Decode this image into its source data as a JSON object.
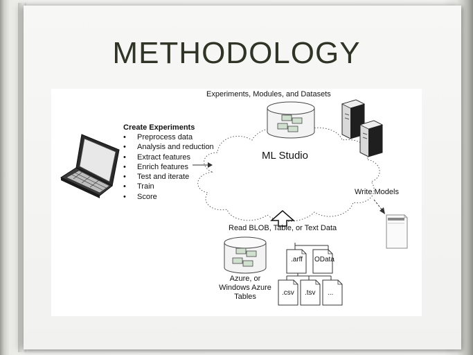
{
  "slide": {
    "title": "METHODOLOGY"
  },
  "diagram": {
    "top_label": "Experiments, Modules, and Datasets",
    "cloud_label": "ML Studio",
    "create_experiments": {
      "heading": "Create Experiments",
      "items": [
        "Preprocess data",
        "Analysis and reduction",
        "Extract features",
        "Enrich features",
        "Test and iterate",
        "Train",
        "Score"
      ]
    },
    "write_models_label": "Write Models",
    "read_label": "Read BLOB, Table, or Text Data",
    "azure_label_lines": [
      "Azure, or",
      "Windows Azure",
      "Tables"
    ],
    "files": [
      ".arff",
      "OData",
      ".csv",
      ".tsv",
      "..."
    ]
  }
}
